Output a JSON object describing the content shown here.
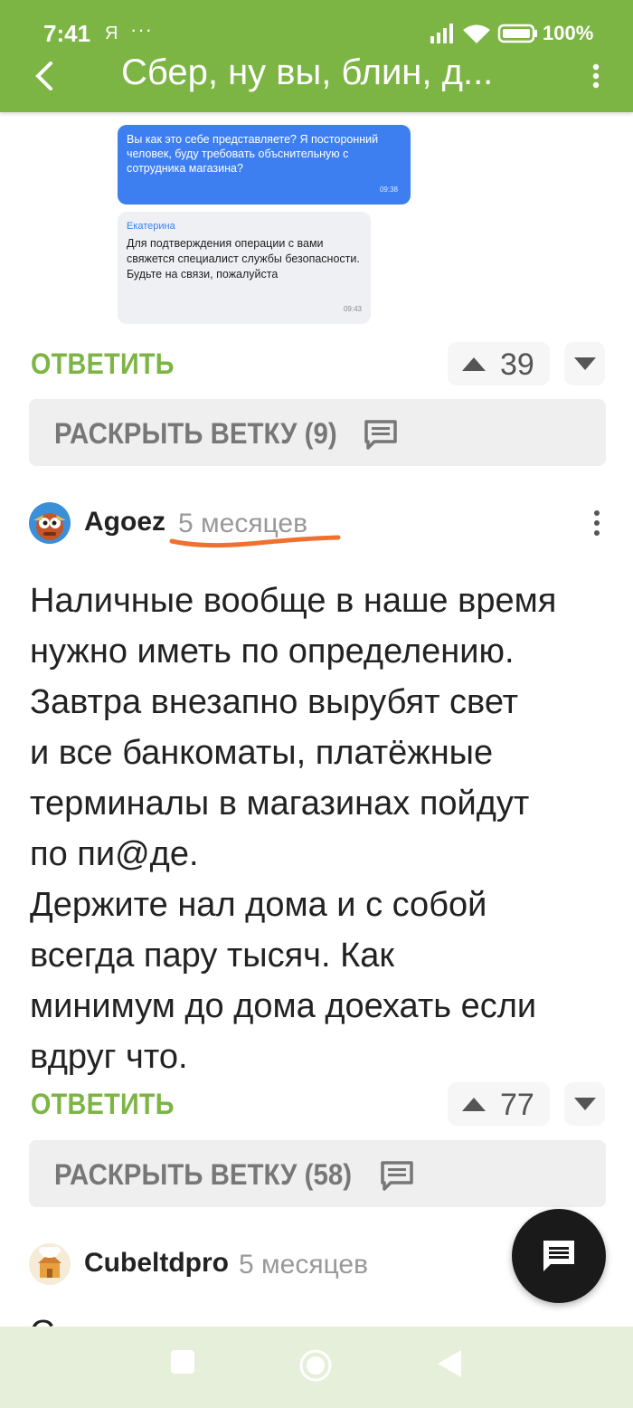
{
  "status_bar": {
    "time": "7:41",
    "carrier": "Я",
    "dots": "···",
    "battery": "100%"
  },
  "header": {
    "title": "Сбер, ну вы, блин, д..."
  },
  "chat_image": {
    "outgoing": {
      "text": "Вы как это себе представляете? Я посторонний человек, буду требовать объснительную с сотрудника магазина?",
      "time": "09:38"
    },
    "incoming": {
      "name": "Екатерина",
      "text": "Для подтверждения операции с вами свяжется специалист службы безопасности. Будьте на связи, пожалуйста",
      "time": "09:43"
    }
  },
  "comment1_actions": {
    "reply_label": "ОТВЕТИТЬ",
    "votes": "39",
    "expand_label": "РАСКРЫТЬ ВЕТКУ (9)"
  },
  "comment2": {
    "author": "Agoez",
    "ago": "5 месяцев",
    "text": "Наличные вообще в наше время\nнужно иметь по определению.\nЗавтра внезапно вырубят свет\nи все банкоматы, платёжные\nтерминалы в магазинах пойдут\nпо пи@де.\nДержите нал дома и с собой\nвсегда пару тысяч. Как\nминимум до дома доехать если\nвдруг что.",
    "reply_label": "ОТВЕТИТЬ",
    "votes": "77",
    "expand_label": "РАСКРЫТЬ ВЕТКУ (58)"
  },
  "comment3": {
    "author": "Cubeltdpro",
    "ago": "5 месяцев",
    "text_partial": "С"
  },
  "colors": {
    "brand_green": "#7db545",
    "annotation_orange": "#f07030",
    "fab": "#1a1a1a"
  },
  "icons": [
    "back-arrow-icon",
    "more-vert-icon",
    "upvote-icon",
    "downvote-icon",
    "comments-icon",
    "chat-fab-icon",
    "nav-square-icon",
    "nav-circle-icon",
    "nav-triangle-icon"
  ]
}
